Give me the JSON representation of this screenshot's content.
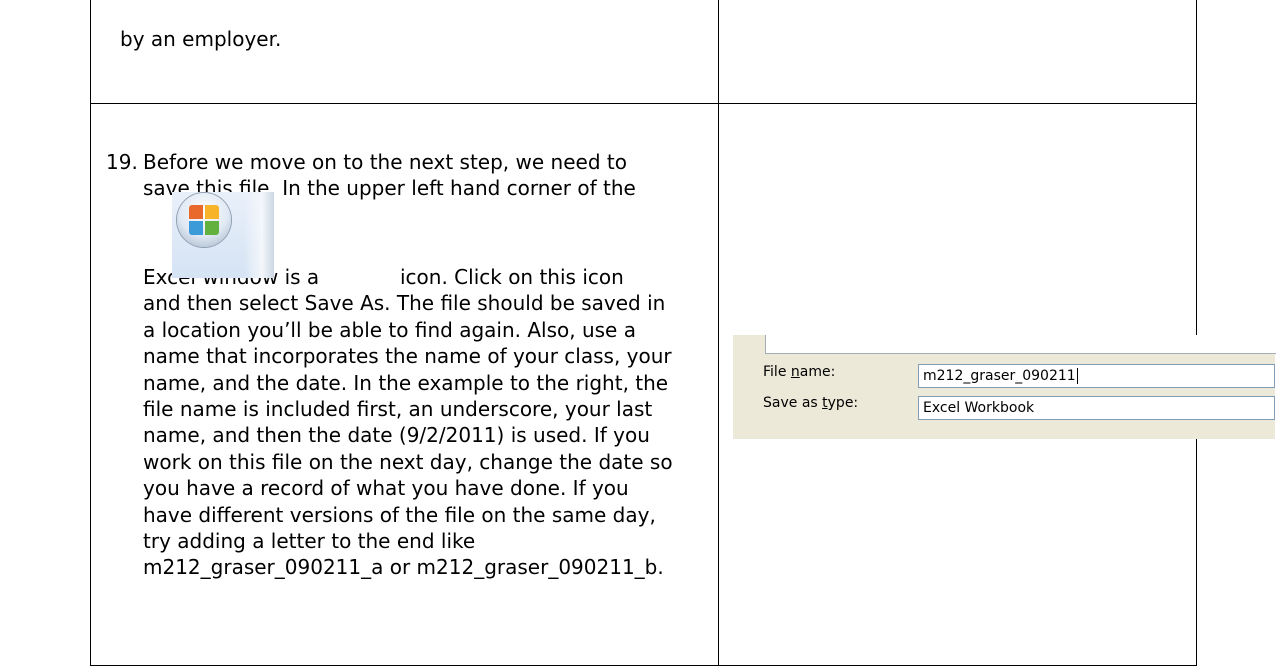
{
  "row1": {
    "text": "by an employer."
  },
  "step": {
    "number": "19.",
    "lines": [
      "Before we move on to the next step, we need to",
      "save this file. In the upper left hand corner of the",
      "Excel window is a",
      "icon. Click on this icon",
      "and then select Save As. The file should be saved in",
      "a location you’ll be able to find again. Also, use a",
      "name that incorporates the name of your class, your",
      "name, and the date.  In the example to the right, the",
      "file name is included first, an underscore, your last",
      "name, and then the date (9/2/2011) is used. If you",
      "work on this file on the next day, change the date so",
      "you have a record of what you have done. If you",
      "have different versions of the file on the same day,",
      "try adding a letter to the end like",
      "m212_graser_090211_a or m212_graser_090211_b."
    ]
  },
  "icons": {
    "office_button": "office-button-icon"
  },
  "dialog": {
    "file_name_label_pre": "File ",
    "file_name_label_u": "n",
    "file_name_label_post": "ame:",
    "file_name_value": "m212_graser_090211",
    "save_type_label_pre": "Save as ",
    "save_type_label_u": "t",
    "save_type_label_post": "ype:",
    "save_type_value": "Excel Workbook"
  }
}
